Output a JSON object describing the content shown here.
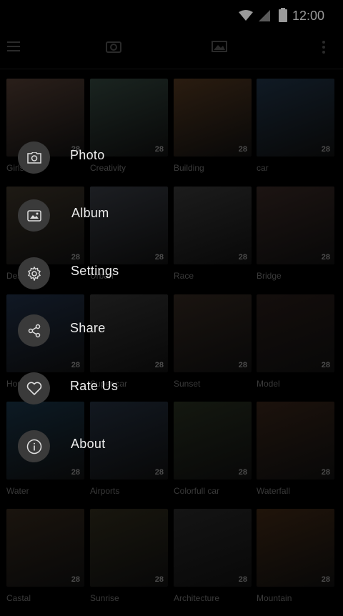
{
  "status": {
    "time": "12:00"
  },
  "grid": {
    "count_label": "28",
    "items": [
      {
        "name": "Girls",
        "color": "#2a1f1a"
      },
      {
        "name": "Creativity",
        "color": "#1a2420"
      },
      {
        "name": "Building",
        "color": "#2a1c10"
      },
      {
        "name": "car",
        "color": "#101a24"
      },
      {
        "name": "Design",
        "color": "#1e1a14"
      },
      {
        "name": "Urban",
        "color": "#1c1e22"
      },
      {
        "name": "Race",
        "color": "#1c1c1c"
      },
      {
        "name": "Bridge",
        "color": "#1c1412"
      },
      {
        "name": "Home",
        "color": "#101824"
      },
      {
        "name": "Super car",
        "color": "#1a1a1a"
      },
      {
        "name": "Sunset",
        "color": "#1a1410"
      },
      {
        "name": "Model",
        "color": "#140e0c"
      },
      {
        "name": "Water",
        "color": "#0c1a24"
      },
      {
        "name": "Airports",
        "color": "#121820"
      },
      {
        "name": "Colorfull car",
        "color": "#141810"
      },
      {
        "name": "Waterfall",
        "color": "#1c120c"
      },
      {
        "name": "Castal",
        "color": "#1a140e"
      },
      {
        "name": "Sunrise",
        "color": "#18160e"
      },
      {
        "name": "Architecture",
        "color": "#141414"
      },
      {
        "name": "Mountain",
        "color": "#20140a"
      }
    ]
  },
  "menu": {
    "items": [
      {
        "label": "Photo",
        "icon": "camera-icon"
      },
      {
        "label": "Album",
        "icon": "album-icon"
      },
      {
        "label": "Settings",
        "icon": "gear-icon"
      },
      {
        "label": "Share",
        "icon": "share-icon"
      },
      {
        "label": "Rate Us",
        "icon": "heart-icon"
      },
      {
        "label": "About",
        "icon": "info-icon"
      }
    ]
  }
}
